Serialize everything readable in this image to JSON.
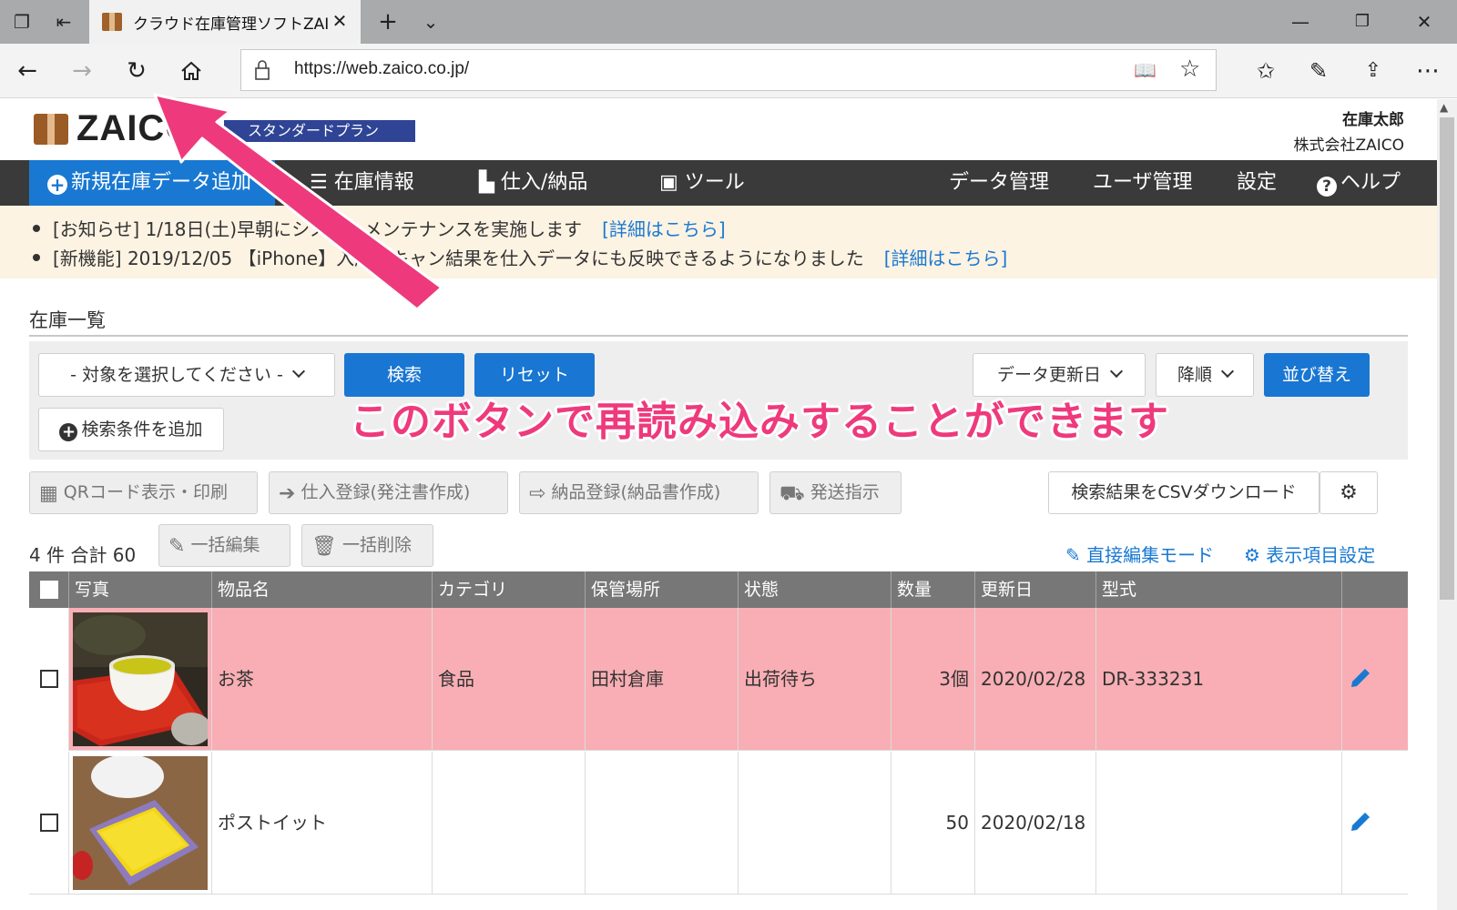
{
  "browser": {
    "tab_title": "クラウド在庫管理ソフトZAI",
    "url": "https://web.zaico.co.jp/"
  },
  "header": {
    "logo": "ZAICO",
    "plan": "スタンダードプラン",
    "user_name": "在庫太郎",
    "company": "株式会社ZAICO"
  },
  "menu": {
    "new": "新規在庫データ追加",
    "inventory": "在庫情報",
    "purchase": "仕入/納品",
    "tools": "ツール",
    "data_mgmt": "データ管理",
    "user_mgmt": "ユーザ管理",
    "settings": "設定",
    "help": "ヘルプ"
  },
  "notices": [
    {
      "text": "[お知らせ] 1/18日(土)早朝にシステムメンテナンスを実施します",
      "link": "[詳細はこちら]"
    },
    {
      "text": "[新機能] 2019/12/05 【iPhone】入庫スキャン結果を仕入データにも反映できるようになりました",
      "link": "[詳細はこちら]"
    }
  ],
  "annotation": "このボタンで再読み込みすることができます",
  "list": {
    "title": "在庫一覧",
    "target_select": "- 対象を選択してください -",
    "search_btn": "検索",
    "reset_btn": "リセット",
    "sort_field": "データ更新日",
    "sort_order": "降順",
    "sort_btn": "並び替え",
    "add_condition": "検索条件を追加",
    "qr_btn": "QRコード表示・印刷",
    "purchase_btn": "仕入登録(発注書作成)",
    "delivery_btn": "納品登録(納品書作成)",
    "ship_btn": "発送指示",
    "csv_btn": "検索結果をCSVダウンロード",
    "count": "4 件 合計 60",
    "bulk_edit": "一括編集",
    "bulk_delete": "一括削除",
    "direct_edit": "直接編集モード",
    "display_settings": "表示項目設定"
  },
  "table": {
    "columns": [
      "写真",
      "物品名",
      "カテゴリ",
      "保管場所",
      "状態",
      "数量",
      "更新日",
      "型式"
    ],
    "rows": [
      {
        "name": "お茶",
        "category": "食品",
        "location": "田村倉庫",
        "status": "出荷待ち",
        "quantity": "3個",
        "updated": "2020/02/28",
        "model": "DR-333231",
        "highlight": true
      },
      {
        "name": "ポストイット",
        "category": "",
        "location": "",
        "status": "",
        "quantity": "50",
        "updated": "2020/02/18",
        "model": "",
        "highlight": false
      }
    ]
  },
  "colors": {
    "accent_blue": "#1976d2",
    "menu_dark": "#3a3a3a",
    "row_highlight": "#f8aeb4",
    "annotation_pink": "#ee3a7c",
    "notice_bg": "#fdf3e3"
  }
}
